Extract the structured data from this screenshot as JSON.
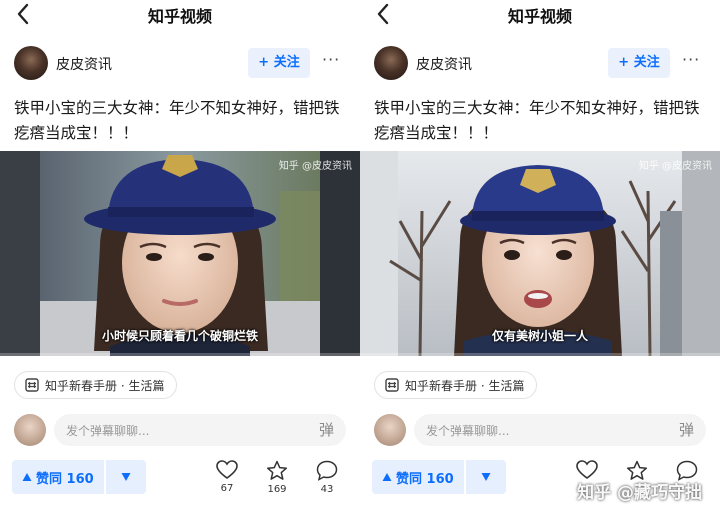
{
  "panels": [
    {
      "topbar": {
        "title": "知乎视频"
      },
      "author": {
        "name": "皮皮资讯",
        "follow_label": "+ 关注",
        "more_label": "···"
      },
      "post": {
        "title": "铁甲小宝的三大女神：年少不知女神好，错把铁疙瘩当成宝！！！"
      },
      "video": {
        "watermark": "知乎 @皮皮资讯",
        "subtitle": "小时候只顾着看几个破铜烂铁",
        "progress": 0.0
      },
      "tag": {
        "label": "知乎新春手册 · 生活篇"
      },
      "danmaku": {
        "placeholder": "发个弹幕聊聊...",
        "send_label": "弹"
      },
      "actions": {
        "vote_label": "赞同 160",
        "like_count": "67",
        "favorite_count": "169",
        "comment_count": "43"
      }
    },
    {
      "topbar": {
        "title": "知乎视频"
      },
      "author": {
        "name": "皮皮资讯",
        "follow_label": "+ 关注",
        "more_label": "···"
      },
      "post": {
        "title": "铁甲小宝的三大女神：年少不知女神好，错把铁疙瘩当成宝！！！"
      },
      "video": {
        "watermark": "知乎 @皮皮资讯",
        "subtitle": "仅有美树小姐一人",
        "progress": 0.0
      },
      "tag": {
        "label": "知乎新春手册 · 生活篇"
      },
      "danmaku": {
        "placeholder": "发个弹幕聊聊...",
        "send_label": "弹"
      },
      "actions": {
        "vote_label": "赞同 160",
        "like_count": "",
        "favorite_count": "",
        "comment_count": ""
      }
    }
  ],
  "bottom_watermark": "知乎 @藏巧守拙",
  "colors": {
    "accent": "#0d6efd",
    "accent_bg": "#e6effd",
    "hat": "#1f2a6b"
  },
  "icons": [
    "back-arrow-icon",
    "more-icon",
    "tag-icon",
    "vote-up-icon",
    "vote-down-icon",
    "heart-icon",
    "star-icon",
    "comment-icon"
  ]
}
